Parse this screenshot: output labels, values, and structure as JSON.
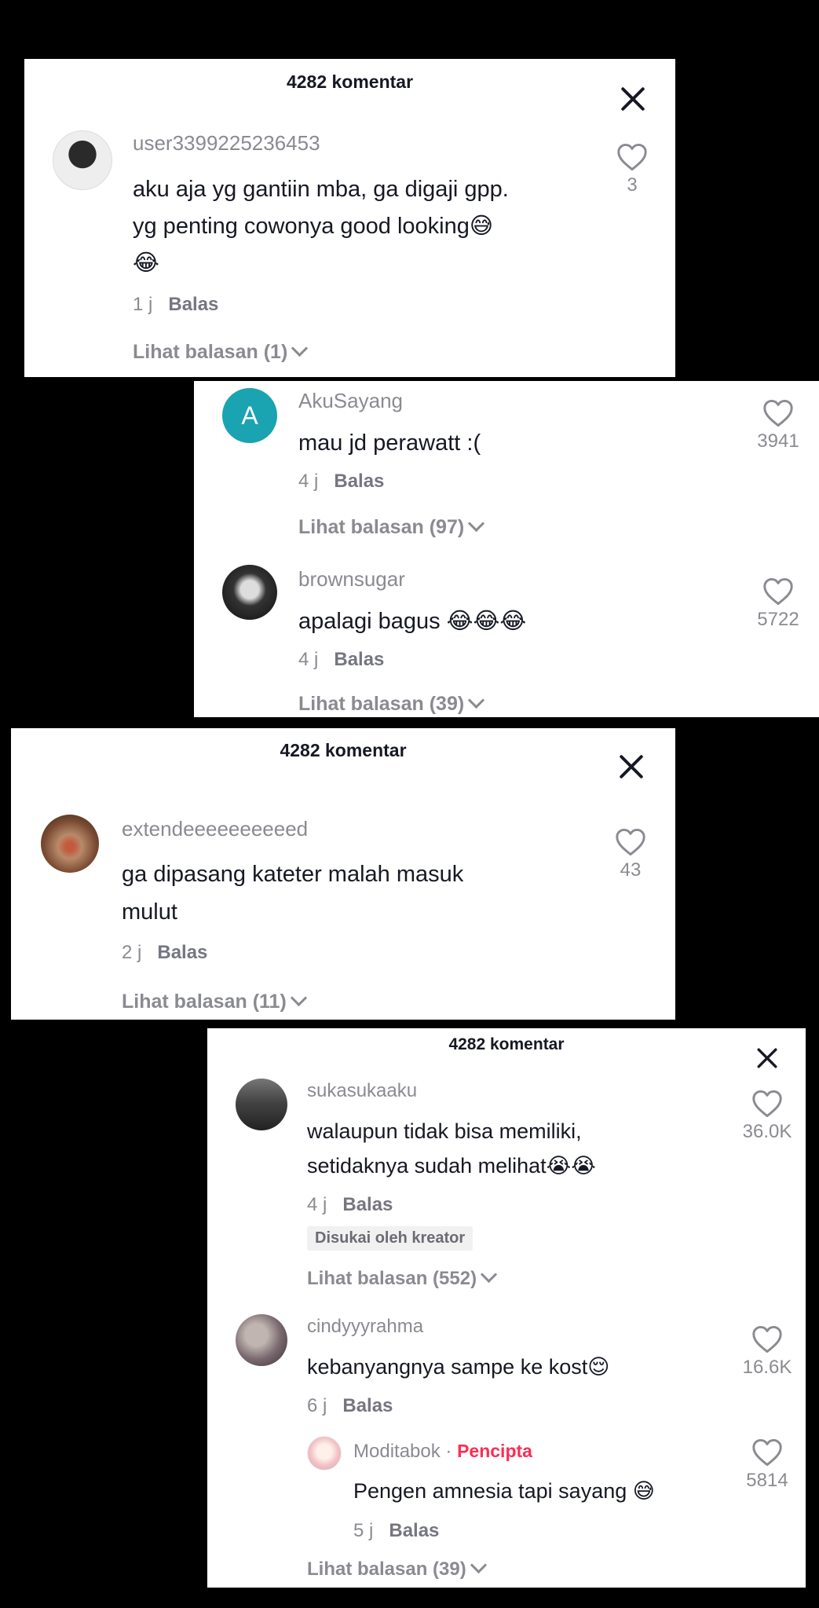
{
  "panel1": {
    "header": "4282 komentar",
    "comment": {
      "username": "user3399225236453",
      "line1": "aku aja yg gantiin mba, ga digaji gpp.",
      "line2": "yg penting cowonya good looking😅",
      "line3": "😂",
      "time": "1 j",
      "reply_label": "Balas",
      "likes": "3",
      "view_replies": "Lihat balasan (1)"
    }
  },
  "panel2": {
    "comments": [
      {
        "avatar_letter": "A",
        "username": "AkuSayang",
        "line1": "mau jd perawatt :(",
        "time": "4 j",
        "reply_label": "Balas",
        "likes": "3941",
        "view_replies": "Lihat balasan (97)"
      },
      {
        "username": "brownsugar",
        "line1": "apalagi bagus 😂😂😂",
        "time": "4 j",
        "reply_label": "Balas",
        "likes": "5722",
        "view_replies": "Lihat balasan (39)"
      }
    ]
  },
  "panel3": {
    "header": "4282 komentar",
    "comment": {
      "username": "extendeeeeeeeeeed",
      "line1": "ga dipasang kateter malah masuk",
      "line2": "mulut",
      "time": "2 j",
      "reply_label": "Balas",
      "likes": "43",
      "view_replies": "Lihat balasan (11)"
    }
  },
  "panel4": {
    "header": "4282 komentar",
    "comments": [
      {
        "username": "sukasukaaku",
        "line1": "walaupun tidak bisa memiliki,",
        "line2": "setidaknya sudah melihat😭😭",
        "time": "4 j",
        "reply_label": "Balas",
        "liked_by_creator": "Disukai oleh kreator",
        "likes": "36.0K",
        "view_replies": "Lihat balasan (552)"
      },
      {
        "username": "cindyyyrahma",
        "line1": "kebanyangnya sampe ke kost😌",
        "time": "6 j",
        "reply_label": "Balas",
        "likes": "16.6K"
      }
    ],
    "reply": {
      "username": "Moditabok",
      "separator": "·",
      "creator_label": "Pencipta",
      "line1": "Pengen amnesia tapi sayang 😅",
      "time": "5 j",
      "reply_label": "Balas",
      "likes": "5814"
    },
    "view_replies": "Lihat balasan (39)"
  },
  "icons": {
    "heart": "heart-outline-icon",
    "close": "close-icon",
    "chevron": "chevron-down-icon"
  },
  "colors": {
    "background": "#000000",
    "panel": "#ffffff",
    "text": "#161823",
    "muted": "#8a8b91",
    "creator": "#fe2c55",
    "avatar_letter_bg": "#1aa3b0"
  }
}
